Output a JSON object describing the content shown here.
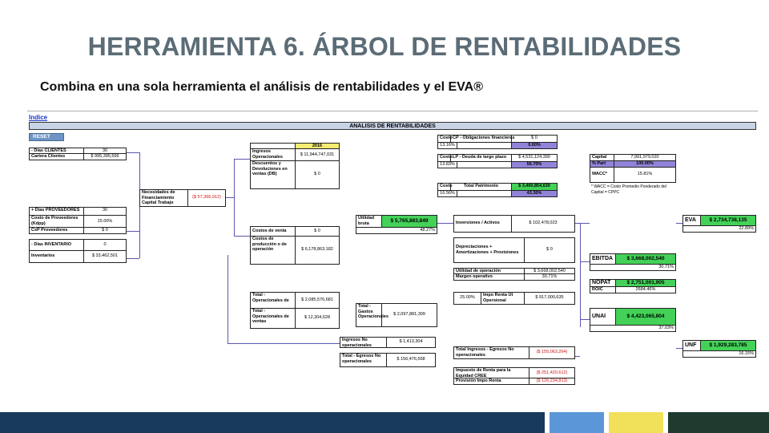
{
  "slide": {
    "title": "HERRAMIENTA 6. ÁRBOL DE RENTABILIDADES",
    "subtitle": "Combina en una sola herramienta el análisis de rentabilidades y el EVA®"
  },
  "sheet": {
    "index_link": "Indice",
    "section_header": "ANALISIS DE RENTABILIDADES",
    "reset_label": "RESET",
    "clientes": {
      "dias_label": "- Días CLIENTES",
      "dias_value": "30",
      "cartera_label": "Cartera Clientes",
      "cartera_value": "$ 995,395,566"
    },
    "proveedores": {
      "dias_label": "+ Días PROVEEDORES",
      "dias_value": "30",
      "costo_label": "Costo de Proveedores (Kdpp)",
      "costo_value": "15.00%",
      "cxp_label": "CxP Proveedores",
      "cxp_value": "$ 0"
    },
    "inventario": {
      "dias_label": "- Días INVENTARIO",
      "dias_value": "0",
      "inv_label": "Inventarios",
      "inv_value": "$ 33,462,501"
    },
    "nft": {
      "label": "Necesidades de Financiamiento Capital Trabajo",
      "value": "($ 57,366,912)"
    },
    "ingresos": {
      "year": "2016",
      "op_label": "Ingresos Operacionales",
      "op_value": "$ 11,944,747,031",
      "dev_label": "Descuentos y Devoluciones en ventas (DB)",
      "dev_value": "$ 0"
    },
    "costos": {
      "ventas_label": "Costos de venta",
      "ventas_value": "$ 0",
      "prod_label": "Costos de producción o de operación",
      "prod_value": "$ 6,178,863,182"
    },
    "utilidad_bruta": {
      "label": "Utilidad bruta",
      "value": "$ 5,765,883,849",
      "pct": "48.27%"
    },
    "gastos": {
      "total_op_label": "Total - Operacionales de",
      "total_op_value": "$ 2,085,576,681",
      "total_ventas_label": "Total - Operacionales de ventas",
      "total_ventas_value": "$ 12,304,628",
      "total_gastos_label": "Total - Gastos Operacionales",
      "total_gastos_value": "$ 2,097,881,309"
    },
    "no_operacionales": {
      "ingresos_label": "Ingresos No operacionales",
      "ingresos_value": "$ 1,413,304",
      "egresos_label": "Total - Egresos No operacionales",
      "egresos_value": "$ 156,476,568"
    },
    "costo_capital": {
      "cp_label": "Costo",
      "cp_desc": "CP - Obligaciones financieras",
      "cp_value": "$ 0",
      "cp_rate": "13.16%",
      "cp_pct": "0.00%",
      "lp_label": "Costo",
      "lp_desc": "LP - Deuda de largo plazo",
      "lp_value": "$ 4,531,124,390",
      "lp_rate": "13.83%",
      "lp_pct": "56.70%",
      "pat_label": "Costo",
      "pat_desc": "Total Patrimonio",
      "pat_value": "$ 3,460,854,630",
      "pat_rate": "16.56%",
      "pat_pct": "43.30%"
    },
    "wacc": {
      "capital_label": "Capital",
      "capital_value": "7,991,979,020",
      "part_label": "% Part",
      "part_value": "100.00%",
      "wacc_label": "WACC*",
      "wacc_value": "15.81%",
      "note": "* WACC = Costo Promedio Ponderado del Capital = CPPC"
    },
    "inversiones": {
      "label": "Inversiones / Activos",
      "value": "$ 102,478,023"
    },
    "depreciaciones": {
      "label": "Depreciaciones + Amortizaciones + Provisiones",
      "value": "$ 0"
    },
    "utilidad_operacion": {
      "label": "Utilidad de operación",
      "value": "$ 3,668,002,540",
      "margen_label": "Margen operativo",
      "margen_value": "30.71%"
    },
    "impuesto_op": {
      "rate": "25.00%",
      "label": "Impo Renta Ut Opersional",
      "value": "$ 917,000,635"
    },
    "total_no_op": {
      "label": "Total Ingresos - Egresos No operacionales",
      "value": "($ 155,063,264)"
    },
    "impuestos": {
      "cree_label": "Impuesto de Renta para la Equidad CREE",
      "cree_value": "($ 251,420,612)",
      "prov_label": "Provisión Impo Renta",
      "prov_value": "($ 126,234,813)"
    },
    "ebitda": {
      "label": "EBITDA",
      "value": "$ 3,668,002,540",
      "pct": "30.71%"
    },
    "nopat": {
      "label": "NOPAT",
      "value": "$ 2,751,001,905",
      "roic_label": "ROIC",
      "roic_value": "2684.46%"
    },
    "unai": {
      "label": "UNAI",
      "value": "$ 4,423,065,804",
      "pct": "37.03%"
    },
    "eva": {
      "label": "EVA",
      "value": "$ 2,734,738,135",
      "pct": "22.89%"
    },
    "unf": {
      "label": "UNF",
      "value": "$ 1,929,283,785",
      "pct": "16.15%"
    }
  }
}
